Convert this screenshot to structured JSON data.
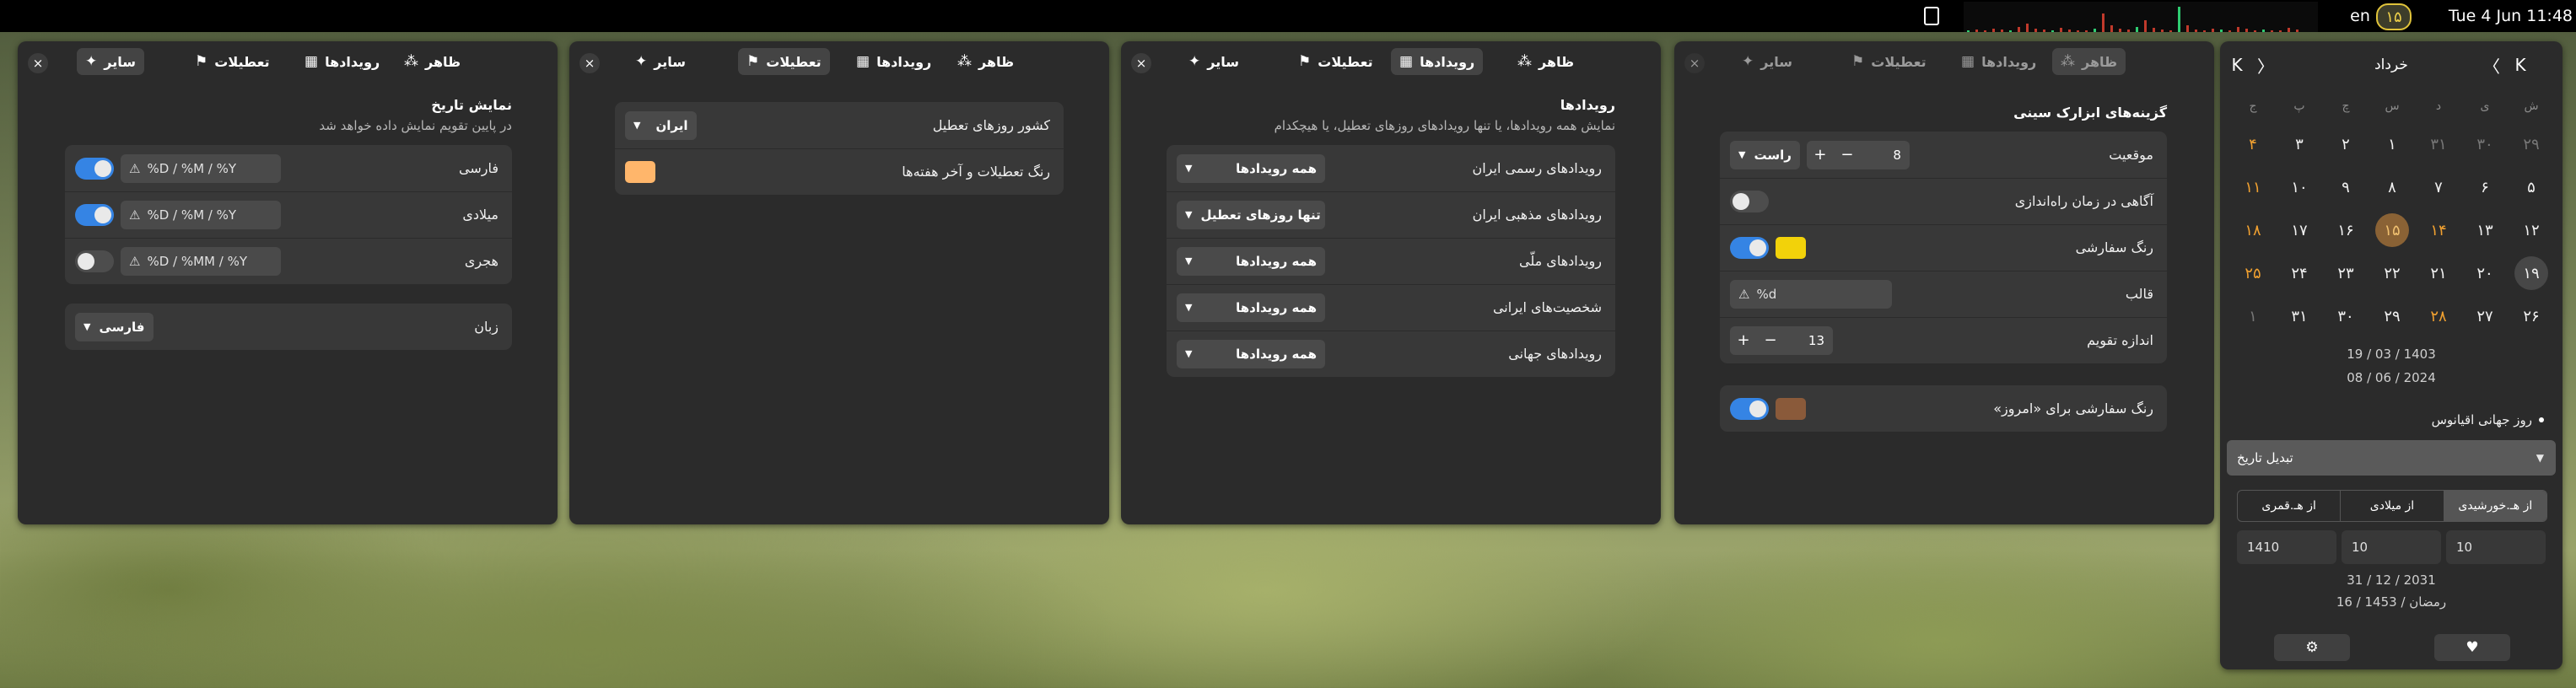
{
  "topbar": {
    "lang": "en",
    "day_badge": "۱۵",
    "clock": "Tue 4 Jun  11:48",
    "clipboard_icon": "clipboard-icon",
    "graph_color": "#2ecc71"
  },
  "tabs": {
    "close": "×",
    "appearance": "ظاهر",
    "events": "رویدادها",
    "holidays": "تعطیلات",
    "other": "سایر",
    "appearance_icon": "palette-icon",
    "events_icon": "calendar-icon",
    "holidays_icon": "holiday-icon",
    "other_icon": "sparkle-icon"
  },
  "appearance_panel": {
    "title": "گزینه‌های ابزارک سینی",
    "rows": {
      "position": {
        "label": "موقعیت",
        "value": "8",
        "dropdown": "راست"
      },
      "admin_notice": {
        "label": "آگاهی در زمان راه‌اندازی"
      },
      "custom_color": {
        "label": "رنگ سفارشی",
        "color": "#f2d20a"
      },
      "format": {
        "label": "قالب",
        "value": "%d"
      },
      "calendar_size": {
        "label": "اندازه تقویم",
        "value": "13"
      }
    },
    "today_color": {
      "label": "رنگ سفارشی برای «امروز»",
      "color": "#8a5a3a"
    }
  },
  "events_panel": {
    "title": "رویدادها",
    "subtitle": "نمایش همه رویدادها، یا تنها رویدادهای روزهای تعطیل، یا هیچکدام",
    "rows": [
      {
        "label": "رویدادهای رسمی ایران",
        "value": "همه رویدادها"
      },
      {
        "label": "رویدادهای مذهبی ایران",
        "value": "تنها روزهای تعطیل"
      },
      {
        "label": "رویدادهای ملّی",
        "value": "همه رویدادها"
      },
      {
        "label": "شخصیت‌های ایرانی",
        "value": "همه رویدادها"
      },
      {
        "label": "رویدادهای جهانی",
        "value": "همه رویدادها"
      }
    ]
  },
  "holidays_panel": {
    "country_label": "کشور روزهای تعطیل",
    "country_value": "ایران",
    "color_label": "رنگ تعطیلات و آخر هفته‌ها",
    "color": "#ffb66b"
  },
  "other_panel": {
    "title": "نمایش تاریخ",
    "subtitle": "در پایین تقویم نمایش داده خواهد شد",
    "rows": [
      {
        "label": "فارسی",
        "format": "%D / %M / %Y"
      },
      {
        "label": "میلادی",
        "format": "%D / %M / %Y"
      },
      {
        "label": "هجری",
        "format": "%D / %MM / %Y"
      }
    ],
    "language_label": "زبان",
    "language_value": "فارسی"
  },
  "calendar": {
    "month": "خرداد",
    "nav": {
      "first": "K",
      "prev": "〈",
      "next": "〉",
      "last": "K"
    },
    "weekdays": [
      "ش",
      "ی",
      "د",
      "س",
      "چ",
      "پ",
      "ج"
    ],
    "weeks": [
      [
        "۲۹",
        "۳۰",
        "۳۱",
        "۱",
        "۲",
        "۳",
        "۴"
      ],
      [
        "۵",
        "۶",
        "۷",
        "۸",
        "۹",
        "۱۰",
        "۱۱"
      ],
      [
        "۱۲",
        "۱۳",
        "۱۴",
        "۱۵",
        "۱۶",
        "۱۷",
        "۱۸"
      ],
      [
        "۱۹",
        "۲۰",
        "۲۱",
        "۲۲",
        "۲۳",
        "۲۴",
        "۲۵"
      ],
      [
        "۲۶",
        "۲۷",
        "۲۸",
        "۲۹",
        "۳۰",
        "۳۱",
        "۱"
      ]
    ],
    "accent": "#f0a030",
    "today_bg": "#8a6235",
    "date_persian": "19 / 03 / 1403",
    "date_gregorian": "08 / 06 / 2024",
    "event": "روز جهانی اقیانوس",
    "convert_label": "تبدیل تاریخ",
    "segments": [
      "از هـ.خورشیدی",
      "از میلادی",
      "از هـ.قمری"
    ],
    "inputs": [
      "10",
      "10",
      "1410"
    ],
    "result_gregorian": "31 / 12 / 2031",
    "result_hijri": "16 / رمضان / 1453",
    "settings_icon": "gear-icon",
    "heart_icon": "heart-icon"
  }
}
